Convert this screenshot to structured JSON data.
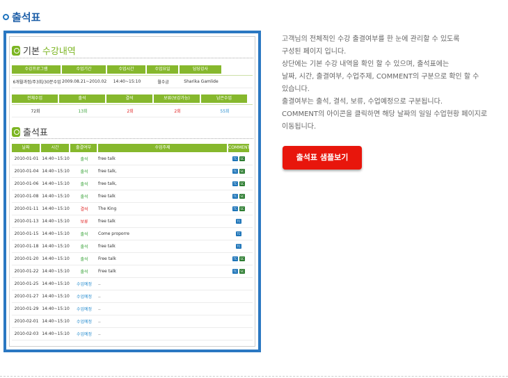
{
  "section_title": "출석표",
  "basic": {
    "title_prefix": "기본",
    "title_suffix": "수강내역",
    "headers": [
      "수강프로그램",
      "수업기간",
      "수업시간",
      "수업요일",
      "담당강사"
    ],
    "values": [
      "6개월과정/주3회/30분수업",
      "2009.08.21~2010.02.03",
      "14:40~15:10",
      "월수금",
      "Sharika Gamlide"
    ]
  },
  "stats": {
    "headers": [
      "전체수업",
      "출석",
      "결석",
      "보류(보강가능)",
      "남은수업"
    ],
    "values": [
      "72회",
      "13회",
      "2회",
      "2회",
      "55회"
    ]
  },
  "attendance": {
    "title": "출석표",
    "headers": [
      "날짜",
      "시간",
      "출결여부",
      "수업주제",
      "COMMENT"
    ],
    "rows": [
      {
        "date": "2010-01-01",
        "time": "14:40~15:10",
        "status": "출석",
        "topic": "free talk"
      },
      {
        "date": "2010-01-04",
        "time": "14:40~15:10",
        "status": "출석",
        "topic": "free talk,"
      },
      {
        "date": "2010-01-06",
        "time": "14:40~15:10",
        "status": "출석",
        "topic": "free talk,"
      },
      {
        "date": "2010-01-08",
        "time": "14:40~15:10",
        "status": "출석",
        "topic": "free talk"
      },
      {
        "date": "2010-01-11",
        "time": "14:40~15:10",
        "status": "결석",
        "topic": "The King"
      },
      {
        "date": "2010-01-13",
        "time": "14:40~15:10",
        "status": "보류",
        "topic": "free talk"
      },
      {
        "date": "2010-01-15",
        "time": "14:40~15:10",
        "status": "출석",
        "topic": "Come proporre"
      },
      {
        "date": "2010-01-18",
        "time": "14:40~15:10",
        "status": "출석",
        "topic": "free talk"
      },
      {
        "date": "2010-01-20",
        "time": "14:40~15:10",
        "status": "출석",
        "topic": "Free talk"
      },
      {
        "date": "2010-01-22",
        "time": "14:40~15:10",
        "status": "출석",
        "topic": "Free talk"
      },
      {
        "date": "2010-01-25",
        "time": "14:40~15:10",
        "status": "수업예정",
        "topic": ".."
      },
      {
        "date": "2010-01-27",
        "time": "14:40~15:10",
        "status": "수업예정",
        "topic": ".."
      },
      {
        "date": "2010-01-29",
        "time": "14:40~15:10",
        "status": "수업예정",
        "topic": ".."
      },
      {
        "date": "2010-02-01",
        "time": "14:40~15:10",
        "status": "수업예정",
        "topic": ".."
      },
      {
        "date": "2010-02-03",
        "time": "14:40~15:10",
        "status": "수업예정",
        "topic": ".."
      }
    ],
    "comments": [
      [
        "TC",
        "SC"
      ],
      [
        "TC",
        "SC"
      ],
      [
        "TC",
        "SC"
      ],
      [
        "TC",
        "SC"
      ],
      [
        "TC",
        "SC"
      ],
      [
        "TC"
      ],
      [
        "TC"
      ],
      [
        "TC"
      ],
      [
        "TC",
        "SC"
      ],
      [
        "TC",
        "SC"
      ],
      [],
      [],
      [],
      [],
      []
    ]
  },
  "description": [
    "고객님의 전체적인 수강 출결여부를 한 눈에 관리할 수 있도록",
    "구성된 페이지 입니다.",
    "상단에는 기본 수강 내역을 확인 할 수 있으며, 출석표에는",
    "날짜, 시간, 출결여부, 수업주제, COMMENT의 구분으로 확인 할 수",
    "있습니다.",
    "출결여부는 출석, 결석, 보류, 수업예정으로 구분됩니다.",
    "COMMENT의 아이콘을 클릭하면 해당 날짜의 일일 수업현황 페이지로",
    "이동됩니다."
  ],
  "sample_button": "출석표 샘플보기",
  "colors": {
    "accent": "#2b78c2",
    "green": "#86b82d",
    "button": "#e8160c"
  }
}
